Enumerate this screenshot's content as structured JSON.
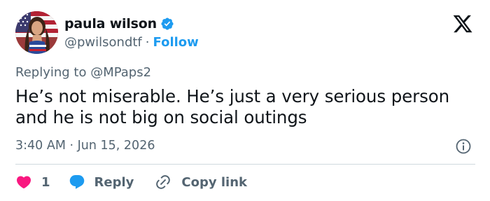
{
  "author": {
    "display_name": "paula wilson",
    "handle": "@pwilsondtf",
    "separator": "·",
    "follow_label": "Follow",
    "verified": true
  },
  "tweet": {
    "replying_to": "Replying to @MPaps2",
    "text": "He’s not miserable. He’s just a very serious person and he is not big on social outings",
    "timestamp": "3:40 AM · Jun 15, 2026"
  },
  "actions": {
    "like_count": "1",
    "reply_label": "Reply",
    "copy_link_label": "Copy link"
  },
  "icons": {
    "verified": "verified-badge-icon",
    "logo": "x-logo-icon",
    "info": "info-icon",
    "like": "heart-icon",
    "reply": "chat-bubble-icon",
    "copy": "link-icon"
  },
  "colors": {
    "accent": "#1d9bf0",
    "like": "#f91880",
    "text": "#0f1419",
    "secondary_text": "#536471",
    "divider": "#cfd9de"
  }
}
